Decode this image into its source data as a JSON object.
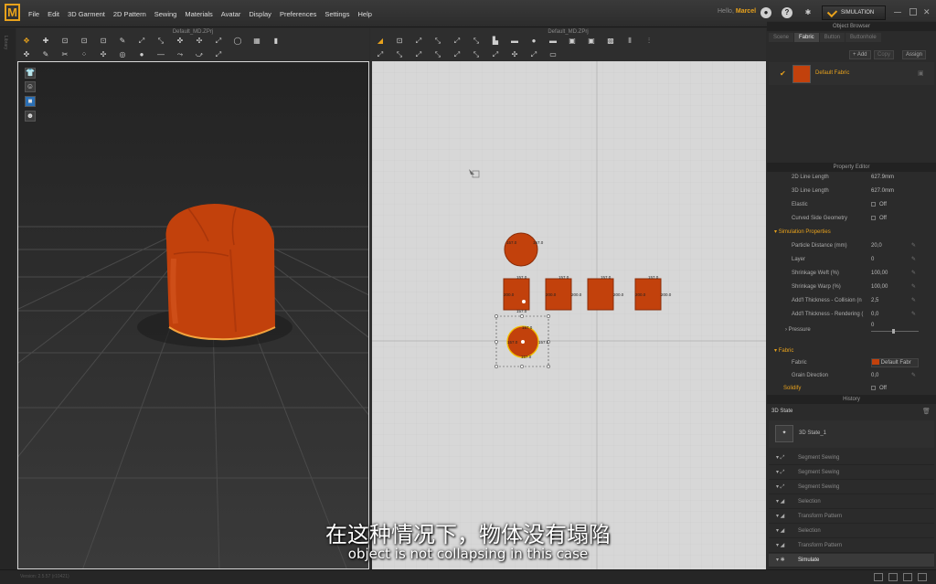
{
  "app": {
    "logo": "M",
    "user_prefix": "Hello,",
    "user_name": "Marcel",
    "sim_label": "SIMULATION"
  },
  "menu": [
    "File",
    "Edit",
    "3D Garment",
    "2D Pattern",
    "Sewing",
    "Materials",
    "Avatar",
    "Display",
    "Preferences",
    "Settings",
    "Help"
  ],
  "left_strip": "Library",
  "panel3d": {
    "title": "Default_MD.ZPrj"
  },
  "panel2d": {
    "title": "Default_MD.ZPrj",
    "labels": {
      "c1t": "157.0",
      "c1l": "157.0",
      "sq1": "157.0",
      "sq1l": "200.0",
      "sq1b": "157.0",
      "sq2": "157.0",
      "sq2l": "200.0",
      "sq2r": "200.0",
      "sq3": "157.0",
      "sq3r": "200.0",
      "sq4": "157.0",
      "sq4l": "200.0",
      "sq4r": "200.0",
      "c2t": "157.0",
      "c2l": "157.0",
      "c2r": "157.0",
      "c2b": "157.0"
    }
  },
  "object_browser": {
    "title": "Object Browser",
    "tabs": [
      "Scene",
      "Fabric",
      "Button",
      "Buttonhole"
    ],
    "active_tab": "Fabric",
    "add": "+ Add",
    "copy": "Copy",
    "assign": "Assign",
    "fabric_name": "Default Fabric"
  },
  "property_editor": {
    "title": "Property Editor",
    "rows_top": [
      {
        "label": "2D Line Length",
        "value": "627.9mm"
      },
      {
        "label": "3D Line Length",
        "value": "627.0mm"
      },
      {
        "label": "Elastic",
        "value": "Off"
      },
      {
        "label": "Curved Side Geometry",
        "value": "Off"
      }
    ],
    "sim_group": "Simulation Properties",
    "sim_rows": [
      {
        "label": "Particle Distance (mm)",
        "value": "20,0"
      },
      {
        "label": "Layer",
        "value": "0"
      },
      {
        "label": "Shrinkage Weft (%)",
        "value": "100,00"
      },
      {
        "label": "Shrinkage Warp (%)",
        "value": "100,00"
      },
      {
        "label": "Add'l Thickness - Collision (n",
        "value": "2,5"
      },
      {
        "label": "Add'l Thickness - Rendering (",
        "value": "0,0"
      }
    ],
    "pressure_label": "Pressure",
    "pressure_value": "0",
    "fabric_group": "Fabric",
    "fabric_label": "Fabric",
    "fabric_value": "Default Fabr",
    "grain_label": "Grain Direction",
    "grain_value": "0,0",
    "solidify_label": "Solidify",
    "solidify_value": "Off"
  },
  "history": {
    "title": "History",
    "state_header": "3D State",
    "state_item": "3D State_1",
    "entries": [
      "Segment Sewing",
      "Segment Sewing",
      "Segment Sewing",
      "Selection",
      "Transform Pattern",
      "Selection",
      "Transform Pattern",
      "Simulate"
    ]
  },
  "subtitles": {
    "cn": "在这种情况下，物体没有塌陷",
    "en": "object is not collapsing in this case"
  },
  "status_text": "Version: 2.5.57   (r10421)",
  "colors": {
    "accent": "#e8a21c",
    "fabric": "#c2410c",
    "grid2d": "#d7d7d7"
  }
}
